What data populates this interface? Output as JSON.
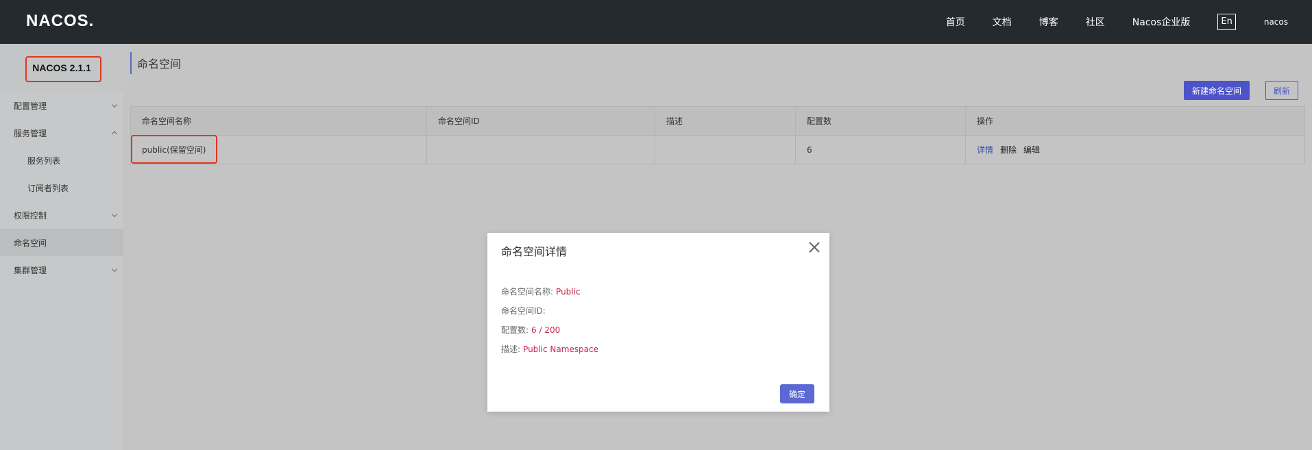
{
  "header": {
    "logo": "NACOS",
    "nav": [
      "首页",
      "文档",
      "博客",
      "社区",
      "Nacos企业版"
    ],
    "lang": "En",
    "user": "nacos"
  },
  "sidebar": {
    "version": "NACOS 2.1.1",
    "items": [
      {
        "label": "配置管理",
        "chevron": "down"
      },
      {
        "label": "服务管理",
        "chevron": "up"
      },
      {
        "label": "服务列表",
        "sub": true
      },
      {
        "label": "订阅者列表",
        "sub": true
      },
      {
        "label": "权限控制",
        "chevron": "down"
      },
      {
        "label": "命名空间",
        "active": true
      },
      {
        "label": "集群管理",
        "chevron": "down"
      }
    ]
  },
  "main": {
    "title": "命名空间",
    "create_button": "新建命名空间",
    "refresh_button": "刷新",
    "table": {
      "headers": [
        "命名空间名称",
        "命名空间ID",
        "描述",
        "配置数",
        "操作"
      ],
      "rows": [
        {
          "name": "public(保留空间)",
          "id": "",
          "desc": "",
          "count": "6",
          "ops": [
            "详情",
            "删除",
            "编辑"
          ]
        }
      ]
    }
  },
  "dialog": {
    "title": "命名空间详情",
    "name_label": "命名空间名称:",
    "name_value": "Public",
    "id_label": "命名空间ID:",
    "id_value": "",
    "count_label": "配置数:",
    "count_value": "6 / 200",
    "desc_label": "描述:",
    "desc_value": "Public Namespace",
    "ok_button": "确定"
  },
  "colors": {
    "topbar": "#252a2f",
    "primary": "#4d53c9",
    "highlight": "#e0361f",
    "value_text": "#c7254e"
  }
}
